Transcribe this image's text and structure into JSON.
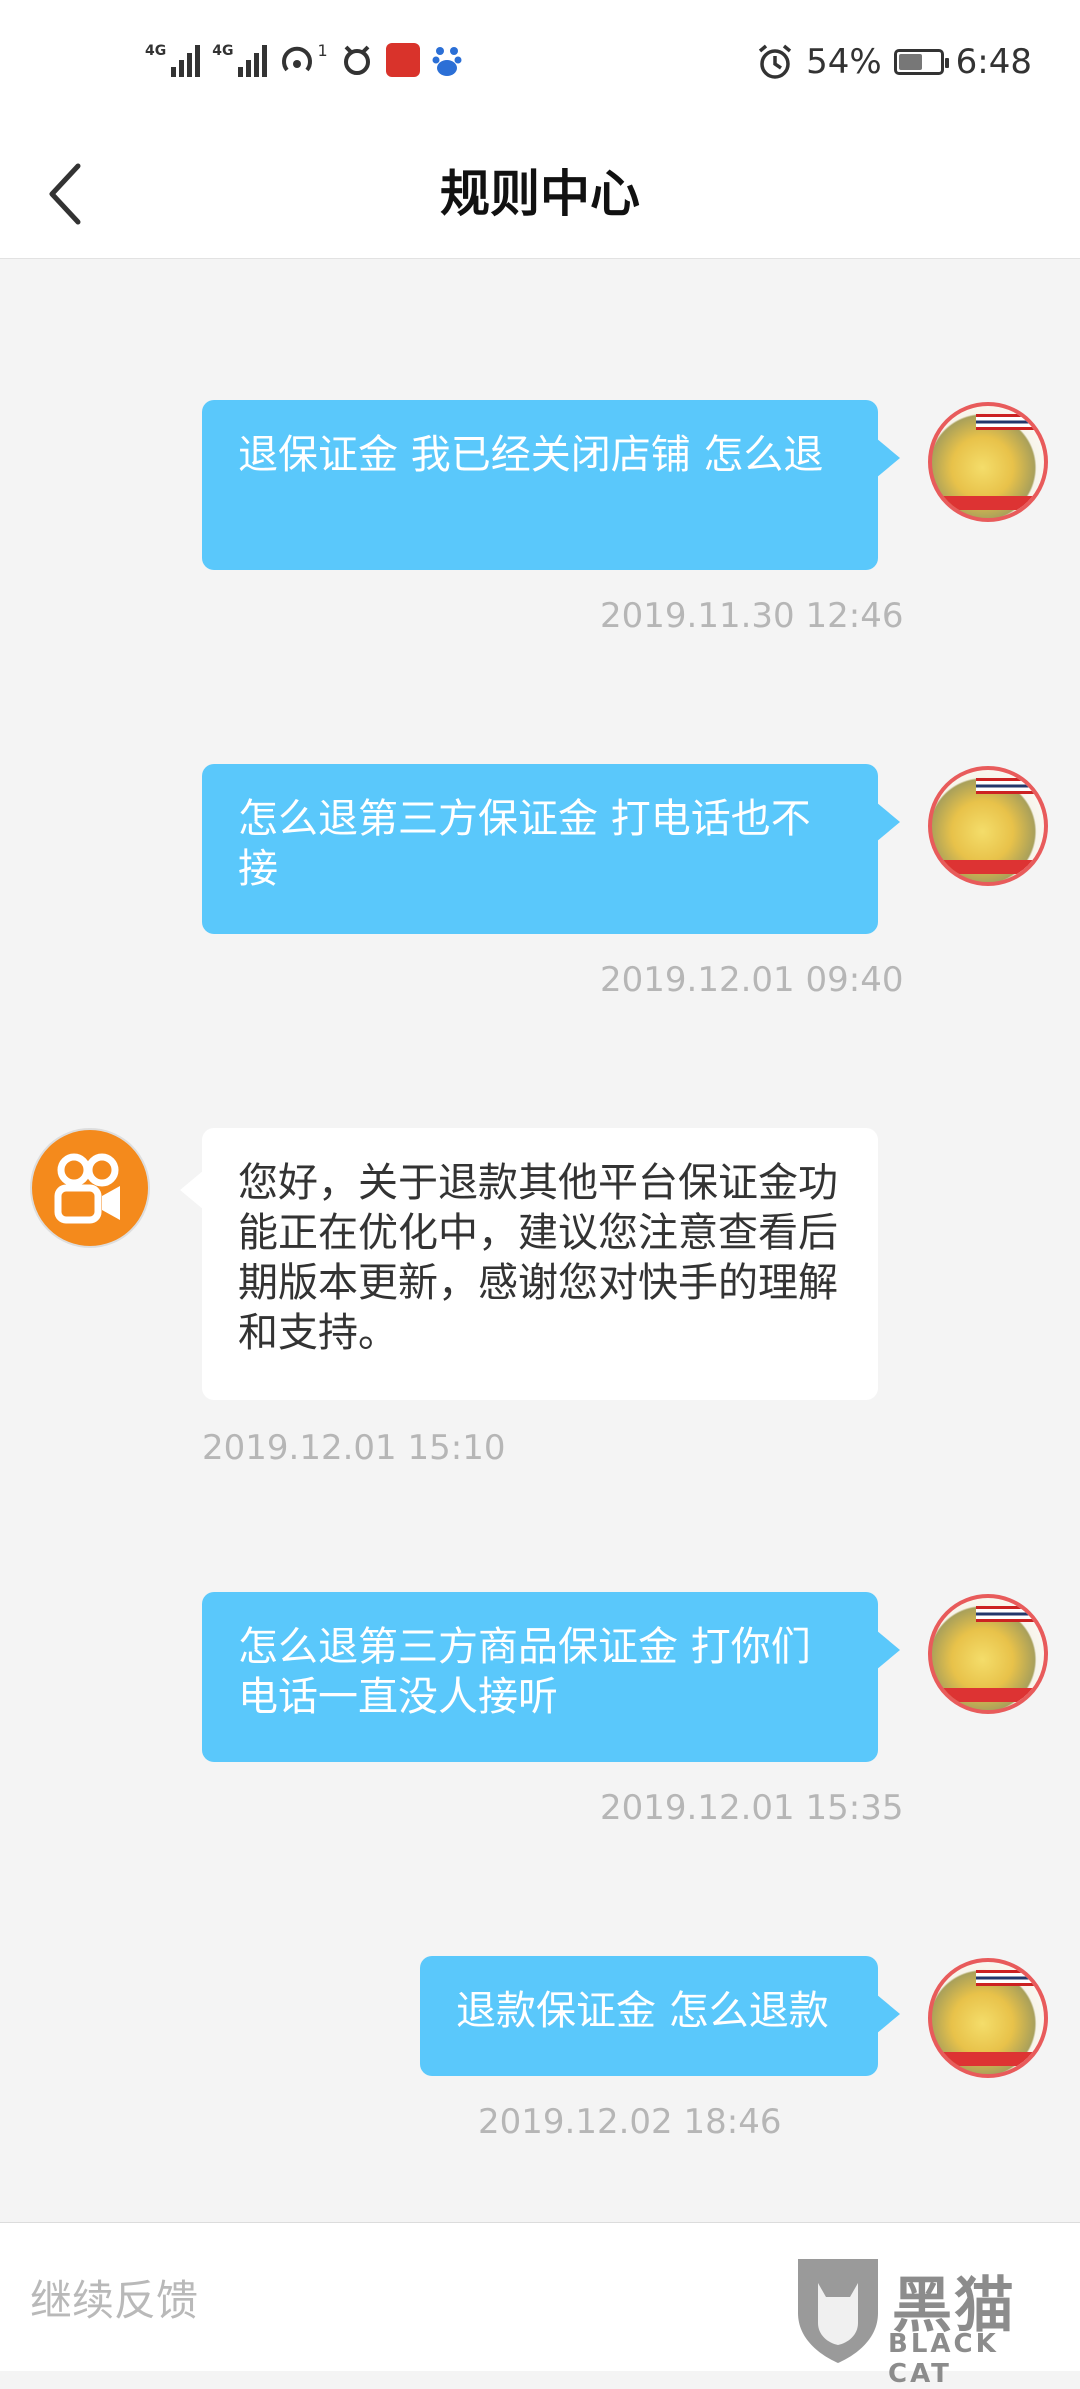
{
  "status_bar": {
    "network_1": "4G",
    "network_2": "4G",
    "wifi_badge": "1",
    "battery_pct": "54%",
    "battery_level": 0.54,
    "time": "6:48"
  },
  "header": {
    "title": "规则中心",
    "back_icon": "chevron-left-icon"
  },
  "messages": [
    {
      "sender": "user",
      "text": "退保证金 我已经关闭店铺 怎么退",
      "time": "2019.11.30 12:46"
    },
    {
      "sender": "user",
      "text": "怎么退第三方保证金 打电话也不接",
      "time": "2019.12.01 09:40"
    },
    {
      "sender": "bot",
      "text": "您好，关于退款其他平台保证金功能正在优化中，建议您注意查看后期版本更新，感谢您对快手的理解和支持。",
      "time": "2019.12.01 15:10"
    },
    {
      "sender": "user",
      "text": "怎么退第三方商品保证金 打你们电话一直没人接听",
      "time": "2019.12.01 15:35"
    },
    {
      "sender": "user",
      "text": "退款保证金 怎么退款",
      "time": "2019.12.02 18:46"
    }
  ],
  "input": {
    "placeholder": "继续反馈"
  },
  "watermark": {
    "text": "黑猫",
    "sub": "BLACK CAT"
  },
  "colors": {
    "user_bubble": "#5ac8fb",
    "bot_avatar": "#f48a1c"
  }
}
